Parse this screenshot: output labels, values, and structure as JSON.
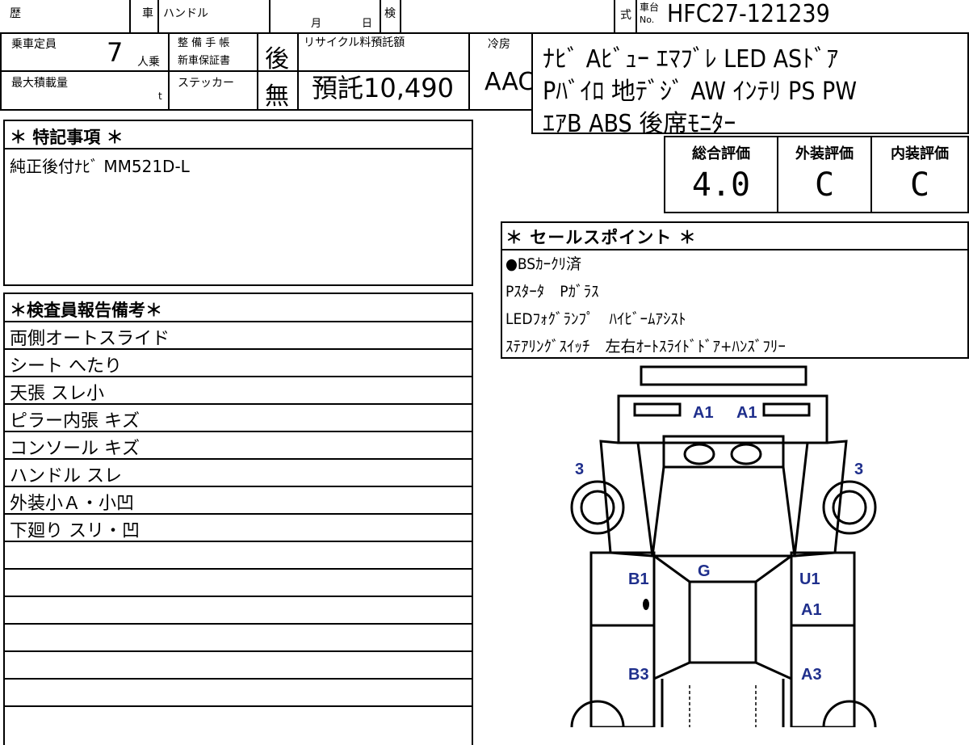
{
  "header": {
    "history_label": "歴",
    "car_label": "車",
    "handle_label": "ハンドル",
    "month_label": "月",
    "day_label": "日",
    "inspection_label": "検",
    "type_label": "式",
    "chassis_label_top": "車台",
    "chassis_label_no": "No.",
    "chassis_number": "HFC27-121239",
    "capacity_label": "乗車定員",
    "capacity_value": "7",
    "capacity_unit": "人乗",
    "maintenance_label_1": "整 備 手 帳",
    "maintenance_label_2": "新車保証書",
    "maintenance_value": "後",
    "recycle_label": "リサイクル料預託額",
    "recycle_value": "預託10,490",
    "ac_label": "冷房",
    "ac_value": "AAC",
    "max_load_label": "最大積載量",
    "max_load_unit": "t",
    "sticker_label": "ステッカー",
    "sticker_value": "無"
  },
  "equipment": {
    "line1": "ﾅﾋﾞ Aﾋﾞｭｰ ｴﾏﾌﾞﾚ LED ASﾄﾞｱ",
    "line2": "Pﾊﾞｲﾛ 地ﾃﾞｼﾞ AW ｲﾝﾃﾘ PS PW",
    "line3": "ｴｱB ABS 後席ﾓﾆﾀｰ"
  },
  "grades": {
    "overall_label": "総合評価",
    "overall_value": "4.0",
    "exterior_label": "外装評価",
    "exterior_value": "C",
    "interior_label": "内装評価",
    "interior_value": "C"
  },
  "special_notes": {
    "title": "＊ 特記事項 ＊",
    "text": "純正後付ﾅﾋﾞ MM521D-L"
  },
  "inspector_report": {
    "title": "＊検査員報告備考＊",
    "items": [
      "両側オートスライド",
      "シート へたり",
      "天張 スレ小",
      "ピラー内張 キズ",
      "コンソール キズ",
      "ハンドル スレ",
      "外装小Ａ・小凹",
      "下廻り スリ・凹",
      "",
      "",
      "",
      "",
      "",
      "",
      ""
    ]
  },
  "sales_points": {
    "title": "＊ セールスポイント ＊",
    "lines": [
      "●BSｶｰｸﾘ済",
      "Pｽﾀｰﾀ　Pｶﾞﾗｽ",
      "LEDﾌｫｸﾞﾗﾝﾌﾟ　ﾊｲﾋﾞｰﾑｱｼｽﾄ",
      "ｽﾃｱﾘﾝｸﾞｽｲｯﾁ　左右ｵｰﾄｽﾗｲﾄﾞﾄﾞｱ+ﾊﾝｽﾞﾌﾘｰ"
    ]
  },
  "diagram": {
    "marks": {
      "front_left": "A1",
      "front_right": "A1",
      "left_front_wheel": "3",
      "right_front_wheel": "3",
      "roof": "G",
      "left_front_door": "B1",
      "left_rear_door": "B3",
      "right_front_door_top": "U1",
      "right_front_door_bottom": "A1",
      "right_rear_door": "A3"
    },
    "mark_color": "#1f2f8c"
  }
}
